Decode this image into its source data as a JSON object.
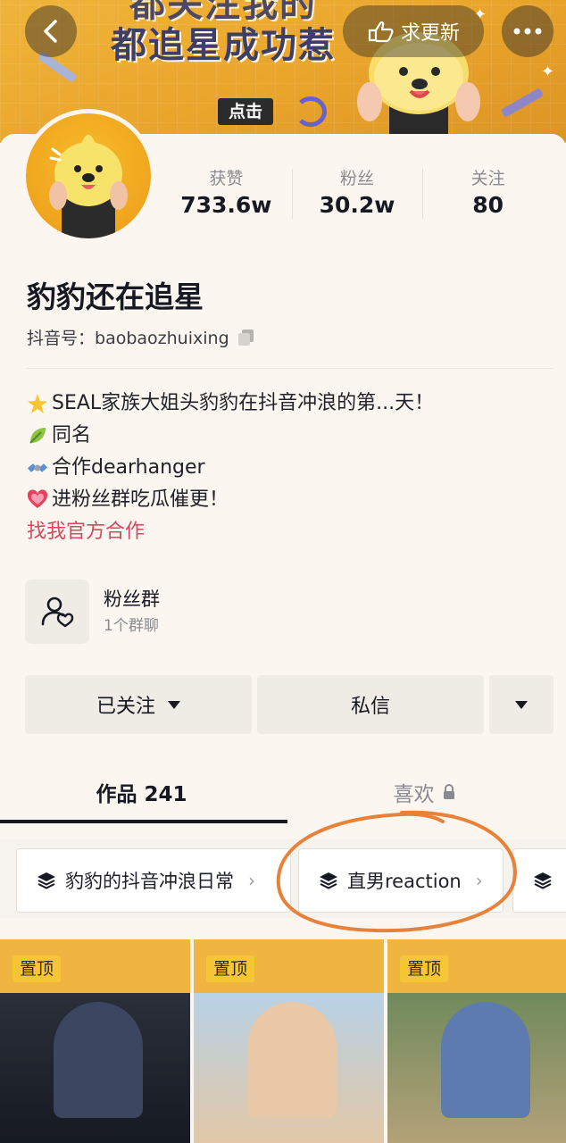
{
  "header": {
    "banner_line1": "都关注我的",
    "banner_line2": "都追星成功惹",
    "banner_tag": "点击",
    "request_update_label": "求更新"
  },
  "profile": {
    "stats": [
      {
        "label": "获赞",
        "value": "733.6w"
      },
      {
        "label": "粉丝",
        "value": "30.2w"
      },
      {
        "label": "关注",
        "value": "80"
      }
    ],
    "nickname": "豹豹还在追星",
    "douyin_id_label": "抖音号：",
    "douyin_id": "baobaozhuixing",
    "bio": [
      {
        "icon": "star-icon",
        "text": "SEAL家族大姐头豹豹在抖音冲浪的第...天！"
      },
      {
        "icon": "leaf-icon",
        "text": "同名"
      },
      {
        "icon": "satellite-icon",
        "text": "合作dearhanger"
      },
      {
        "icon": "heart-icon",
        "text": "进粉丝群吃瓜催更！"
      }
    ],
    "official_link": "找我官方合作"
  },
  "fan_group": {
    "title": "粉丝群",
    "subtitle": "1个群聊"
  },
  "actions": {
    "followed_label": "已关注",
    "message_label": "私信"
  },
  "tabs": {
    "works_label": "作品 241",
    "likes_label": "喜欢"
  },
  "collections": [
    {
      "label": "豹豹的抖音冲浪日常"
    },
    {
      "label": "直男reaction"
    }
  ],
  "videos": [
    {
      "pinned_label": "置顶"
    },
    {
      "pinned_label": "置顶"
    },
    {
      "pinned_label": "置顶"
    }
  ],
  "colors": {
    "accent_link": "#d4495e",
    "banner": "#e9a42b",
    "annotation": "#e8823a"
  }
}
